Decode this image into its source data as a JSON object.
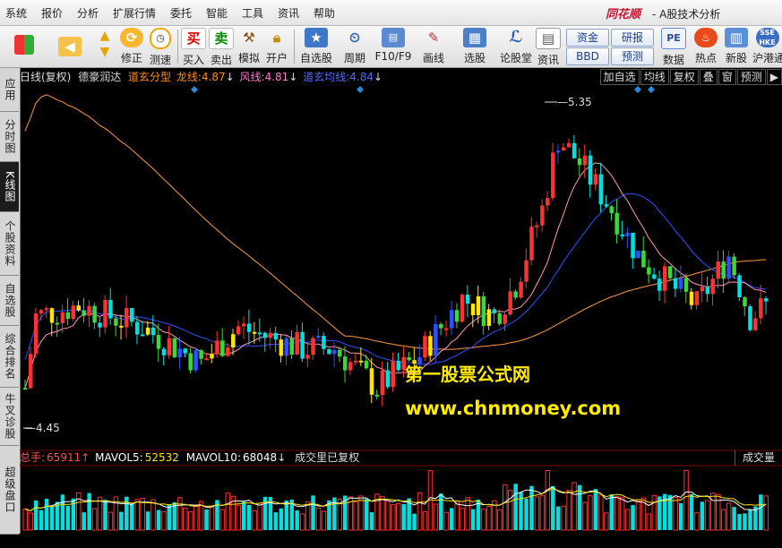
{
  "menubar": {
    "items": [
      "系统",
      "报价",
      "分析",
      "扩展行情",
      "委托",
      "智能",
      "工具",
      "资讯",
      "帮助"
    ],
    "brand": "同花顺",
    "app_title": "- A股技术分析"
  },
  "toolbar": {
    "buttons": [
      {
        "label": "修正",
        "icon": "refresh-icon"
      },
      {
        "label": "测速",
        "icon": "clock-icon"
      },
      {
        "label": "买入",
        "icon": "buy-icon",
        "glyph": "买"
      },
      {
        "label": "卖出",
        "icon": "sell-icon",
        "glyph": "卖"
      },
      {
        "label": "模拟",
        "icon": "hammer-icon"
      },
      {
        "label": "开户",
        "icon": "lock-icon"
      },
      {
        "label": "自选股",
        "icon": "star-icon"
      },
      {
        "label": "周期",
        "icon": "period-icon"
      },
      {
        "label": "F10/F9",
        "icon": "f10-icon"
      },
      {
        "label": "画线",
        "icon": "pencil-icon"
      },
      {
        "label": "选股",
        "icon": "screen-icon"
      },
      {
        "label": "论股堂",
        "icon": "forum-icon"
      },
      {
        "label": "资讯",
        "icon": "news-icon"
      },
      {
        "label": "数据",
        "icon": "pe-icon",
        "glyph": "PE"
      },
      {
        "label": "热点",
        "icon": "hot-icon"
      },
      {
        "label": "新股",
        "icon": "newstock-icon"
      },
      {
        "label": "沪港通",
        "icon": "sse-hkex-icon"
      }
    ],
    "pills": [
      "资金",
      "研报",
      "BBD",
      "预测"
    ]
  },
  "left_tabs": [
    "应用",
    "分时图",
    "K线图",
    "个股资料",
    "自选股",
    "综合排名",
    "牛叉诊股",
    "超级盘口"
  ],
  "active_left_tab": "K线图",
  "indicator_strip": {
    "period": "日线(复权)",
    "stock_name": "德豪润达",
    "indicator_name": "道玄分型",
    "dragon_label": "龙线:",
    "dragon_value": "4.87",
    "wind_label": "风线:",
    "wind_value": "4.81",
    "ma_label": "道玄均线:",
    "ma_value": "4.84",
    "down_arrow": "↓"
  },
  "right_buttons": [
    "加自选",
    "均线",
    "复权",
    "叠",
    "窗",
    "预测",
    "▶"
  ],
  "price_markers": {
    "high": "5.35",
    "low": "4.45"
  },
  "volume_strip": {
    "total_label": "总手:",
    "total_value": "65911",
    "up_arrow": "↑",
    "mavol5_label": "MAVOL5:",
    "mavol5_value": "52532",
    "mavol10_label": "MAVOL10:",
    "mavol10_value": "68048",
    "down_arrow": "↓",
    "note": "成交里已复权",
    "tag": "成交量"
  },
  "watermark": {
    "line1": "第一股票公式网",
    "line2": "www.chnmoney.com"
  },
  "colors": {
    "up": "#ff3030",
    "down": "#00e0e0",
    "green": "#3ad83a",
    "yellow": "#ffe600",
    "blue": "#3050ff",
    "ma_slow": "#ff9944",
    "ma_fast": "#ff99bb",
    "ma_mid": "#3050ff"
  }
}
